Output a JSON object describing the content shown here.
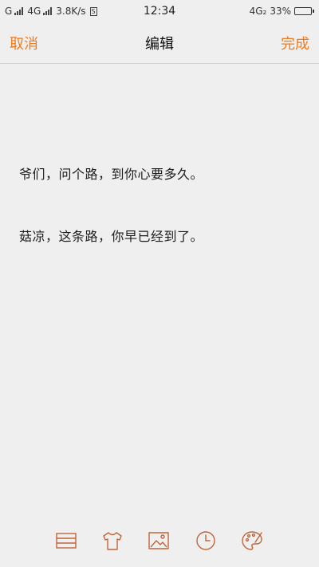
{
  "status_bar": {
    "carrier1": "G",
    "carrier2": "4G",
    "speed": "3.8K/s",
    "speed_badge": "S",
    "time": "12:34",
    "network_right": "4G₂",
    "battery_percent": "33%",
    "battery_level": 0.33
  },
  "nav": {
    "cancel_label": "取消",
    "title": "编辑",
    "done_label": "完成"
  },
  "note": {
    "lines": [
      "爷们，问个路，到你心要多久。",
      "菇凉，这条路，你早已经到了。"
    ]
  },
  "toolbar": {
    "icons": [
      "list-icon",
      "shirt-icon",
      "image-icon",
      "clock-icon",
      "palette-icon"
    ],
    "accent_color": "#c0653a"
  },
  "colors": {
    "accent": "#f07a1e",
    "background": "#efefef"
  }
}
